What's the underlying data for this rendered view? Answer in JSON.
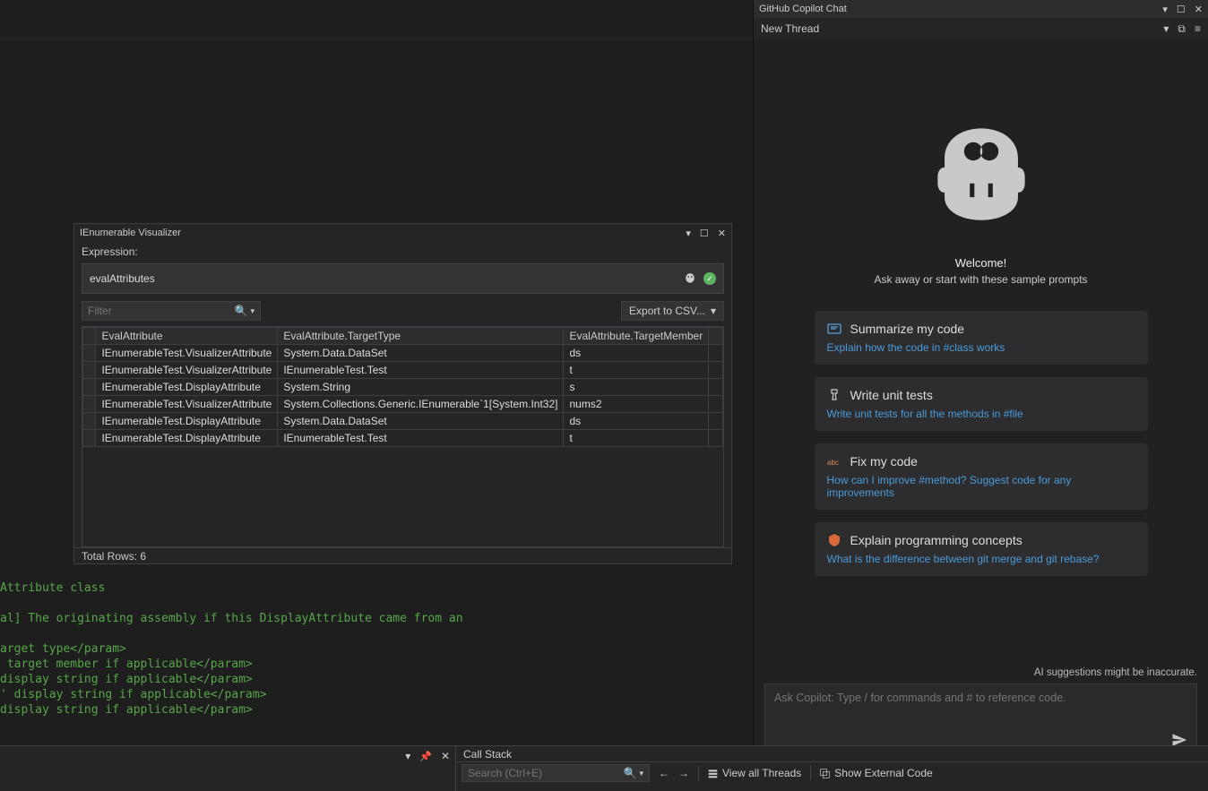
{
  "copilot": {
    "title": "GitHub Copilot Chat",
    "thread": "New Thread",
    "welcome_title": "Welcome!",
    "welcome_subtitle": "Ask away or start with these sample prompts",
    "disclaimer": "AI suggestions might be inaccurate.",
    "input_placeholder": "Ask Copilot: Type / for commands and # to reference code.",
    "cards": [
      {
        "title": "Summarize my code",
        "subtitle": "Explain how the code in #class works"
      },
      {
        "title": "Write unit tests",
        "subtitle": "Write unit tests for all the methods in #file"
      },
      {
        "title": "Fix my code",
        "subtitle": "How can I improve #method? Suggest code for any improvements"
      },
      {
        "title": "Explain programming concepts",
        "subtitle": "What is the difference between git merge and git rebase?"
      }
    ]
  },
  "visualizer": {
    "title": "IEnumerable Visualizer",
    "expression_label": "Expression:",
    "expression": "evalAttributes",
    "filter_placeholder": "Filter",
    "export_label": "Export to CSV...",
    "columns": [
      "EvalAttribute",
      "EvalAttribute.TargetType",
      "EvalAttribute.TargetMember"
    ],
    "rows": [
      [
        "IEnumerableTest.VisualizerAttribute",
        "System.Data.DataSet",
        "ds"
      ],
      [
        "IEnumerableTest.VisualizerAttribute",
        "IEnumerableTest.Test",
        "t"
      ],
      [
        "IEnumerableTest.DisplayAttribute",
        "System.String",
        "s"
      ],
      [
        "IEnumerableTest.VisualizerAttribute",
        "System.Collections.Generic.IEnumerable`1[System.Int32]",
        "nums2"
      ],
      [
        "IEnumerableTest.DisplayAttribute",
        "System.Data.DataSet",
        "ds"
      ],
      [
        "IEnumerableTest.DisplayAttribute",
        "IEnumerableTest.Test",
        "t"
      ]
    ],
    "status": "Total Rows: 6"
  },
  "code_lines": [
    "Attribute class",
    "",
    "al] The originating assembly if this DisplayAttribute came from an",
    "",
    "arget type</param>",
    " target member if applicable</param>",
    "display string if applicable</param>",
    "' display string if applicable</param>",
    "display string if applicable</param>"
  ],
  "callstack": {
    "title": "Call Stack",
    "search_placeholder": "Search (Ctrl+E)",
    "view_all": "View all Threads",
    "show_external": "Show External Code"
  }
}
